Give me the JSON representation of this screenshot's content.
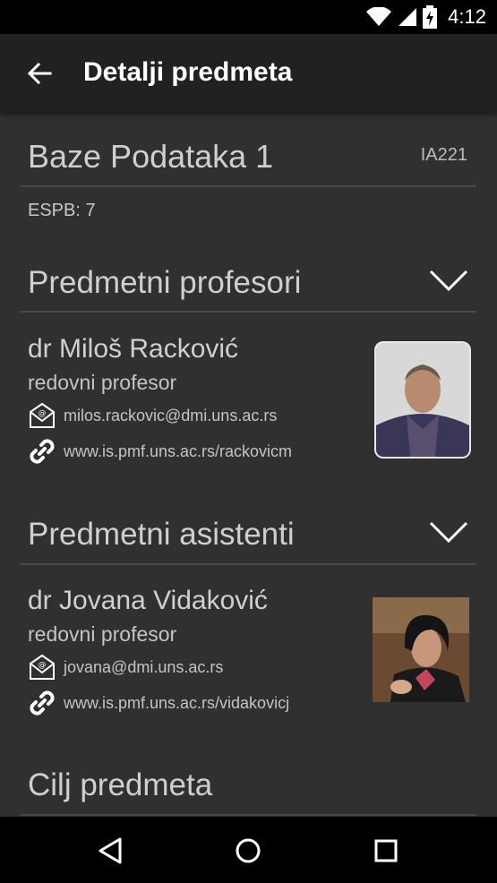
{
  "status_bar": {
    "time": "4:12",
    "icons": [
      "wifi-icon",
      "signal-icon",
      "battery-charging-icon"
    ]
  },
  "toolbar": {
    "title": "Detalji predmeta",
    "back_icon": "arrow-back-icon"
  },
  "course": {
    "title": "Baze Podataka 1",
    "code": "IA221",
    "espb": "ESPB: 7"
  },
  "professors_section": {
    "title": "Predmetni profesori",
    "toggle_icon": "chevron-down-icon",
    "people": [
      {
        "name": "dr Miloš Racković",
        "role": "redovni profesor",
        "email": "milos.rackovic@dmi.uns.ac.rs",
        "website": "www.is.pmf.uns.ac.rs/rackovicm"
      }
    ]
  },
  "assistants_section": {
    "title": "Predmetni asistenti",
    "toggle_icon": "chevron-down-icon",
    "people": [
      {
        "name": "dr Jovana Vidaković",
        "role": "redovni profesor",
        "email": "jovana@dmi.uns.ac.rs",
        "website": "www.is.pmf.uns.ac.rs/vidakovicj"
      }
    ]
  },
  "goal_section": {
    "title": "Cilj predmeta"
  },
  "nav_bar": {
    "icons": [
      "nav-back-icon",
      "nav-home-icon",
      "nav-recents-icon"
    ]
  }
}
